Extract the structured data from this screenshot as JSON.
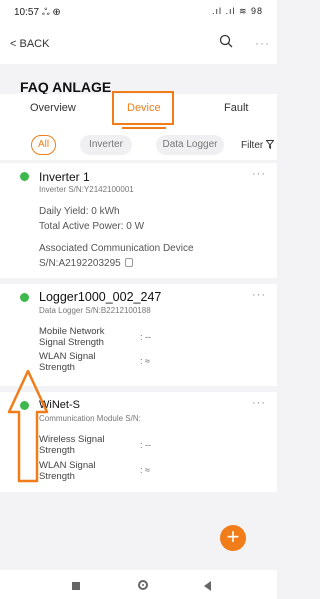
{
  "status_bar": {
    "time": "10:57",
    "extra_icons": "ஃ ⊕",
    "signal": ".ıl .ıl ≋ 98"
  },
  "header": {
    "back_label": "< BACK",
    "more": "···"
  },
  "page_title": "FAQ ANLAGE",
  "tabs": [
    {
      "label": "Overview"
    },
    {
      "label": "Device"
    },
    {
      "label": "Fault"
    }
  ],
  "active_tab": "Device",
  "filters": {
    "chips": [
      "All",
      "Inverter",
      "Data Logger"
    ],
    "selected": "All",
    "filter_label": "Filter"
  },
  "devices": [
    {
      "name": "Inverter 1",
      "serial": "Inverter S/N:Y2142100001",
      "daily_yield": "Daily Yield: 0 kWh",
      "active_power": "Total Active Power: 0 W",
      "assoc_label": "Associated Communication Device",
      "assoc_sn": "S/N:A2192203295",
      "more": "···",
      "status_color": "#3cb84c"
    },
    {
      "name": "Logger1000_002_247",
      "serial": "Data Logger S/N:B2212100188",
      "more": "···",
      "rows": [
        {
          "label": "Mobile Network Signal Strength",
          "value": ": --"
        },
        {
          "label": "WLAN Signal Strength",
          "value": ": ≈"
        }
      ],
      "status_color": "#3cb84c"
    },
    {
      "name": "WiNet-S",
      "serial": "Communication Module S/N:",
      "more": "···",
      "rows": [
        {
          "label": "Wireless Signal Strength",
          "value": ": --"
        },
        {
          "label": "WLAN Signal Strength",
          "value": ": ≈"
        }
      ],
      "status_color": "#3cb84c"
    }
  ],
  "fab_label": "+",
  "colors": {
    "accent": "#f07d1a",
    "online": "#3cb84c",
    "background": "#f3f3f5"
  }
}
